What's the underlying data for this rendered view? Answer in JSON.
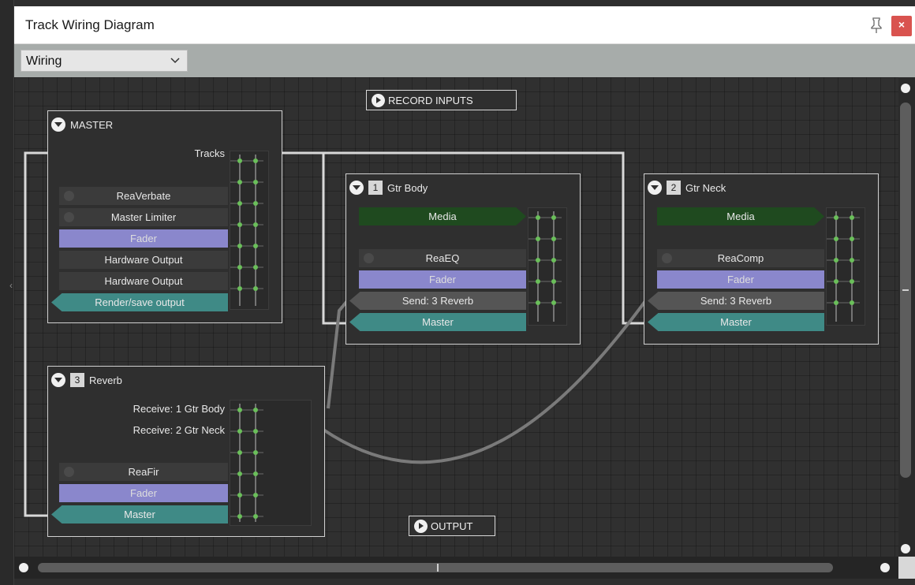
{
  "window": {
    "title": "Track Wiring Diagram"
  },
  "toolbar": {
    "view_select": "Wiring"
  },
  "record_inputs": "RECORD INPUTS",
  "output": "OUTPUT",
  "master": {
    "title": "MASTER",
    "tracks_label": "Tracks",
    "slots": [
      "ReaVerbate",
      "Master Limiter",
      "Fader",
      "Hardware Output",
      "Hardware Output",
      "Render/save output"
    ]
  },
  "gtr_body": {
    "number": "1",
    "name": "Gtr Body",
    "slots": [
      "Media",
      "ReaEQ",
      "Fader",
      "Send: 3 Reverb",
      "Master"
    ]
  },
  "gtr_neck": {
    "number": "2",
    "name": "Gtr Neck",
    "slots": [
      "Media",
      "ReaComp",
      "Fader",
      "Send: 3 Reverb",
      "Master"
    ]
  },
  "reverb": {
    "number": "3",
    "name": "Reverb",
    "slots": [
      "Receive: 1 Gtr Body",
      "Receive: 2 Gtr Neck",
      "ReaFir",
      "Fader",
      "Master"
    ]
  },
  "colors": {
    "fader": "#8a87cc",
    "media": "#1f4a1f",
    "output": "#3f8a86",
    "pin": "#6abf5a",
    "close": "#d9534f"
  },
  "icons": [
    "pin-icon",
    "close-icon",
    "chevron-down-icon",
    "collapse-icon",
    "play-icon",
    "scroll-arrow-icon"
  ]
}
